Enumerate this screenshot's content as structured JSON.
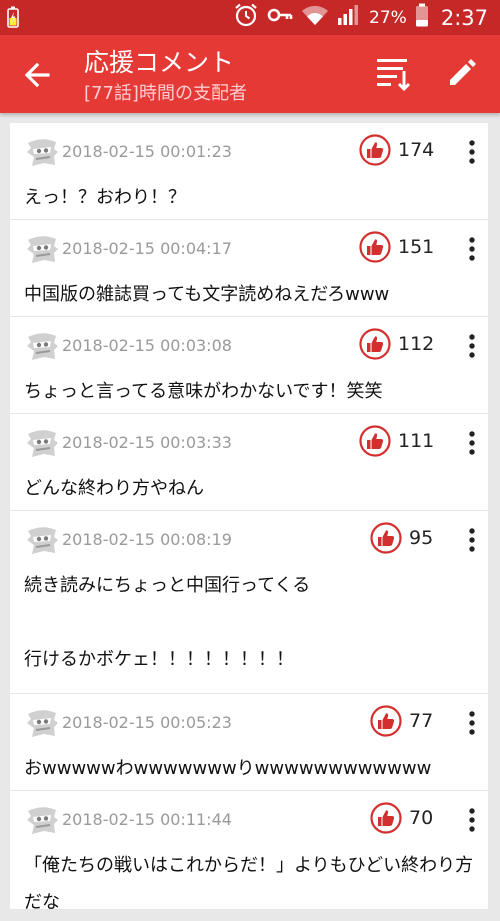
{
  "status_bar": {
    "battery_percent": "27%",
    "time": "2:37",
    "icons": [
      "battery-charging-icon",
      "alarm-icon",
      "vpn-key-icon",
      "wifi-icon",
      "signal-icon",
      "battery-icon"
    ]
  },
  "app_bar": {
    "title": "応援コメント",
    "subtitle": "[77話]時間の支配者",
    "icons": [
      "back-arrow-icon",
      "sort-icon",
      "edit-icon"
    ]
  },
  "comments": [
    {
      "date": "2018-02-15 00:01:23",
      "likes": "174",
      "text": "えっ！？おわり！？"
    },
    {
      "date": "2018-02-15 00:04:17",
      "likes": "151",
      "text": "中国版の雑誌買っても文字読めねえだろwww"
    },
    {
      "date": "2018-02-15 00:03:08",
      "likes": "112",
      "text": "ちょっと言ってる意味がわかないです！笑笑"
    },
    {
      "date": "2018-02-15 00:03:33",
      "likes": "111",
      "text": "どんな終わり方やねん"
    },
    {
      "date": "2018-02-15 00:08:19",
      "likes": "95",
      "text": "続き読みにちょっと中国行ってくる\n\n行けるかボケェ！！！！！！！！"
    },
    {
      "date": "2018-02-15 00:05:23",
      "likes": "77",
      "text": "おwwwwwわwwwwwwwりwwwwwwwwwwww"
    },
    {
      "date": "2018-02-15 00:11:44",
      "likes": "70",
      "text": "「俺たちの戦いはこれからだ！」よりもひどい終わり方だな"
    }
  ],
  "colors": {
    "status_bar": "#c62828",
    "app_bar": "#e53935",
    "like_accent": "#d32f2f",
    "background": "#e8e8e8"
  }
}
